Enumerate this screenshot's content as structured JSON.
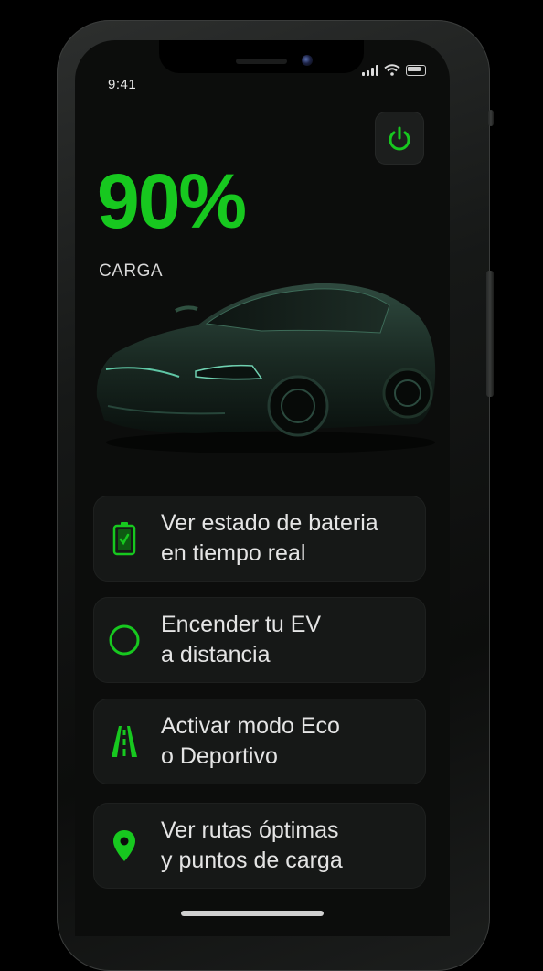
{
  "status_bar": {
    "time": "9:41"
  },
  "dashboard": {
    "charge_value": "90%",
    "charge_label": "CARGA",
    "power_icon": "power-icon"
  },
  "features": [
    {
      "icon": "battery-icon",
      "line1": "Ver estado de bateria",
      "line2": "en tiempo real"
    },
    {
      "icon": "circle-icon",
      "line1": "Encender tu EV",
      "line2": "a distancia"
    },
    {
      "icon": "road-icon",
      "line1": "Activar modo Eco",
      "line2": "o Deportivo"
    },
    {
      "icon": "map-pin-icon",
      "line1": "Ver rutas óptimas",
      "line2": "y puntos de carga"
    }
  ],
  "colors": {
    "accent": "#17c81f",
    "background": "#0c0d0c",
    "card": "#161817",
    "text": "#e4e4e4"
  }
}
